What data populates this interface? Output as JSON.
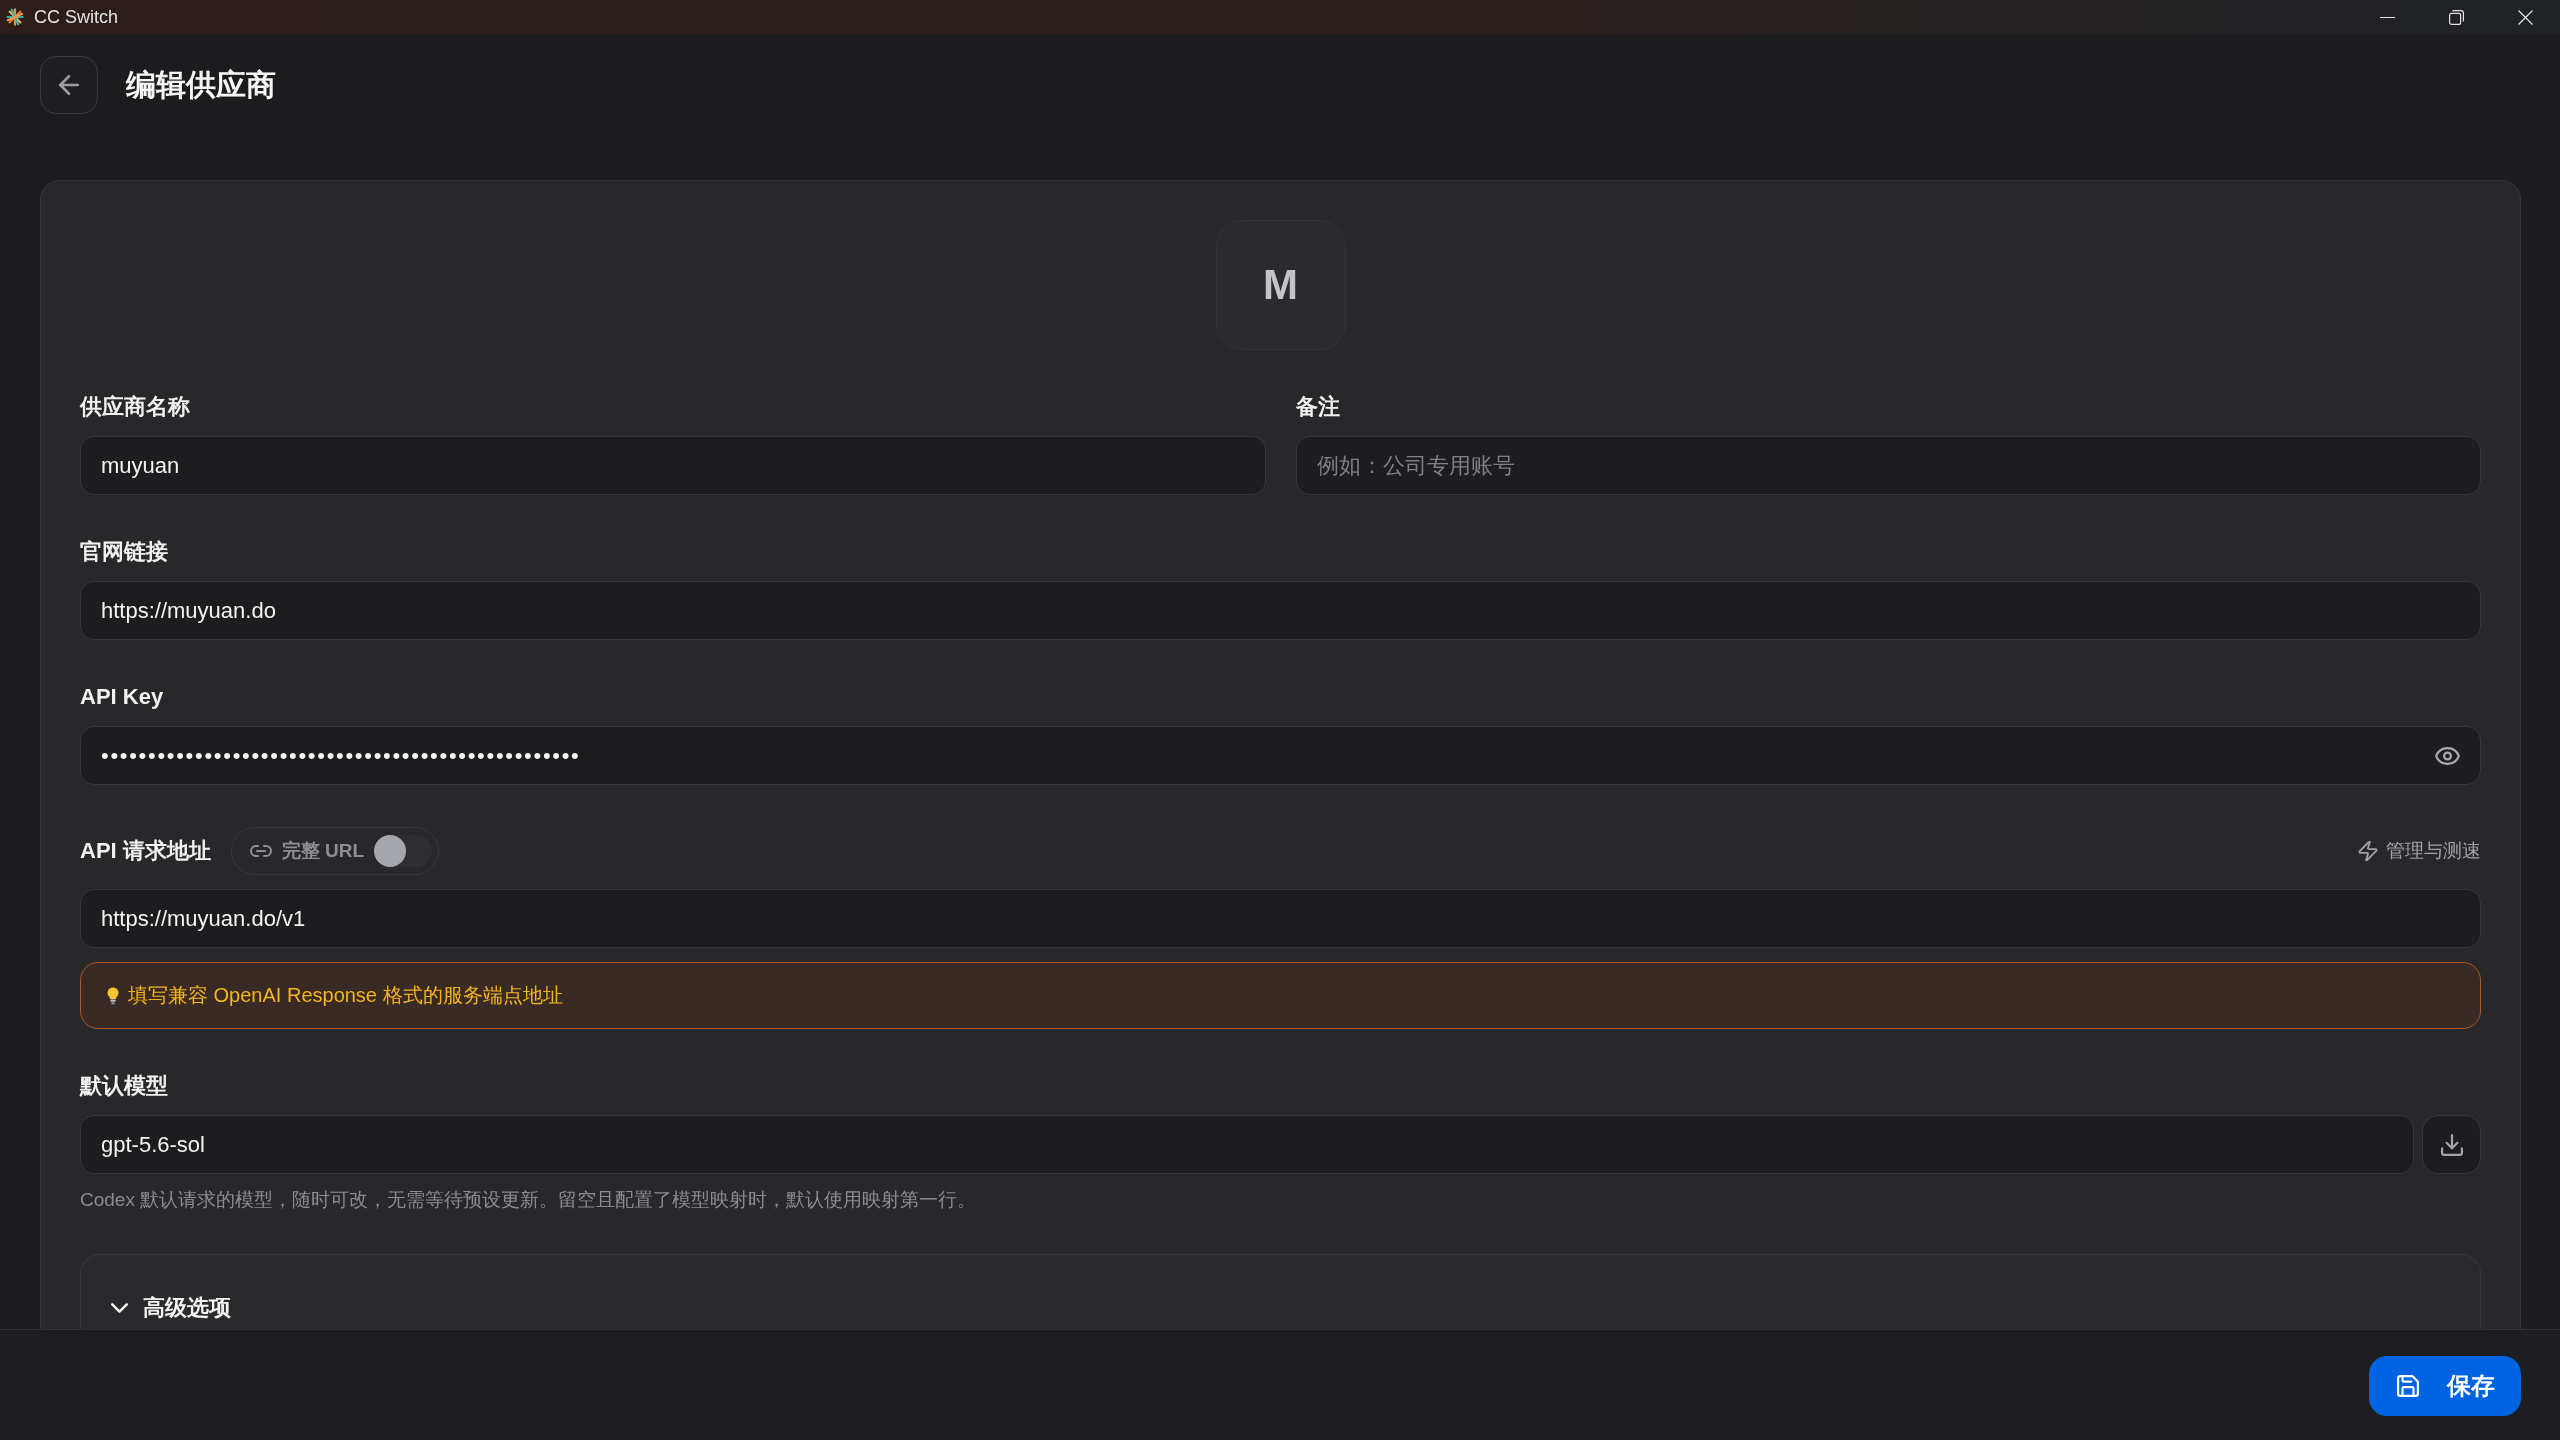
{
  "window": {
    "title": "CC Switch"
  },
  "header": {
    "title": "编辑供应商"
  },
  "provider_icon": {
    "letter": "M"
  },
  "form": {
    "provider_name": {
      "label": "供应商名称",
      "value": "muyuan"
    },
    "notes": {
      "label": "备注",
      "placeholder": "例如：公司专用账号"
    },
    "website": {
      "label": "官网链接",
      "value": "https://muyuan.do"
    },
    "api_key": {
      "label": "API Key",
      "value": "•••••••••••••••••••••••••••••••••••••••••••••••••••"
    },
    "api_endpoint": {
      "label": "API 请求地址",
      "full_url": {
        "label": "完整 URL",
        "on": false
      },
      "action": "管理与测速",
      "value": "https://muyuan.do/v1",
      "notice": "填写兼容 OpenAI Response 格式的服务端点地址"
    },
    "default_model": {
      "label": "默认模型",
      "value": "gpt-5.6-sol",
      "hint": "Codex 默认请求的模型，随时可改，无需等待预设更新。留空且配置了模型映射时，默认使用映射第一行。"
    },
    "advanced": {
      "label": "高级选项"
    }
  },
  "footer": {
    "save": {
      "label": "保存"
    }
  }
}
